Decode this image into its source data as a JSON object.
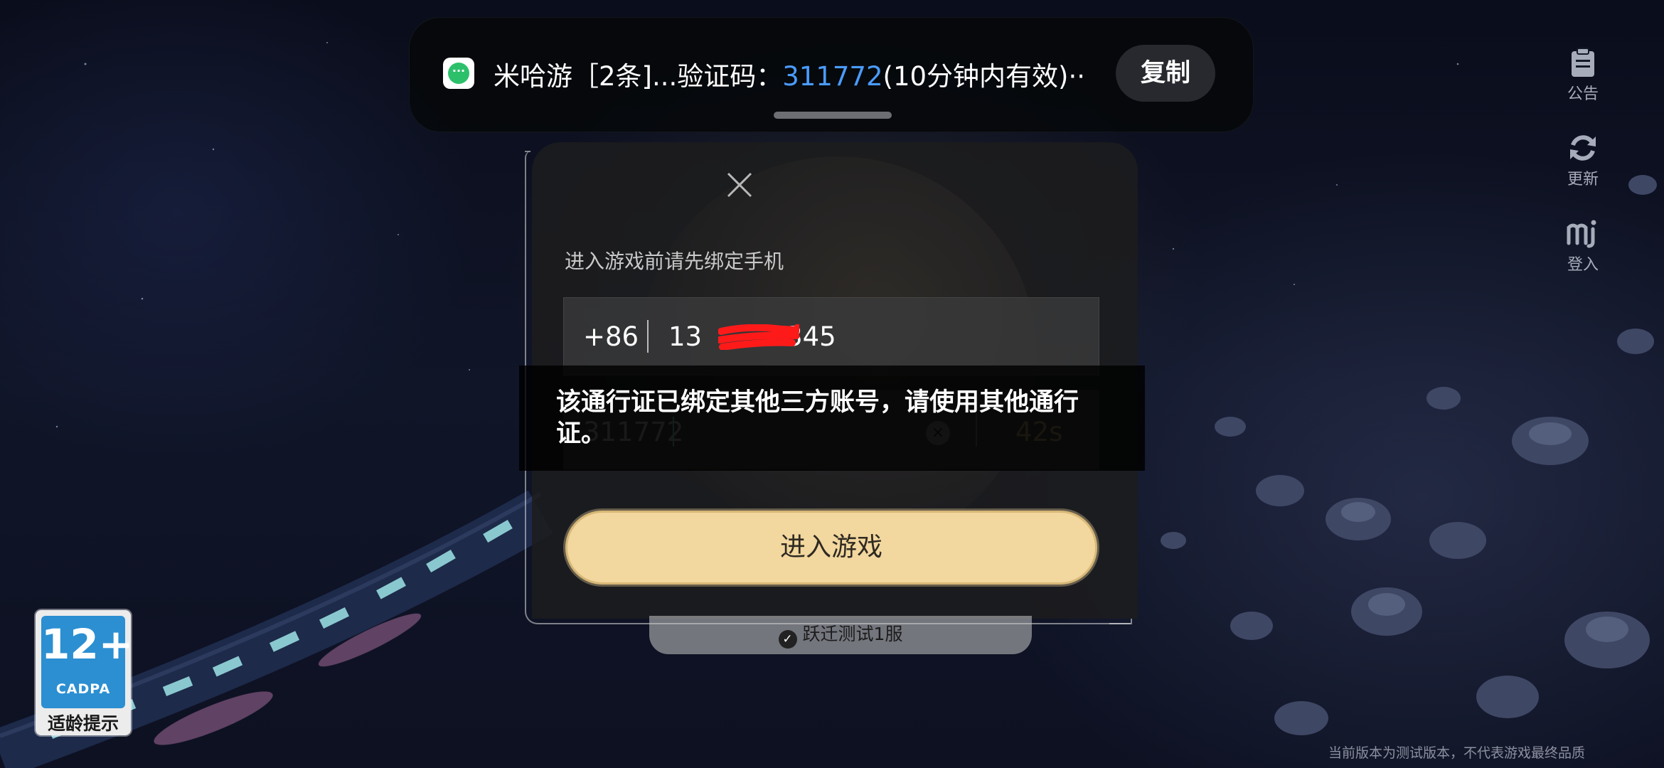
{
  "notification": {
    "app_icon": "message-bubble-icon",
    "text_prefix": "米哈游［2条]...验证码：",
    "code": "311772",
    "text_suffix": "(10分钟内有效)··",
    "copy_label": "复制"
  },
  "right_rail": {
    "announcement_label": "公告",
    "update_label": "更新",
    "login_label": "登入"
  },
  "dialog": {
    "title": "进入游戏前请先绑定手机",
    "country_code": "+86",
    "phone_visible_start": "13",
    "phone_visible_end": "345",
    "verification_code": "311772",
    "countdown": "42s",
    "clear_icon": "×",
    "submit_label": "进入游戏"
  },
  "server": {
    "label": "跃迁测试1服"
  },
  "toast": {
    "message": "该通行证已绑定其他三方账号，请使用其他通行证。"
  },
  "age_rating": {
    "age": "12+",
    "org": "CADPA",
    "label": "适龄提示"
  },
  "footer": {
    "note": "当前版本为测试版本，不代表游戏最终品质"
  },
  "colors": {
    "accent_blue": "#4a9cff",
    "button_gold": "#f2d79f",
    "rating_blue": "#2b8fd2"
  }
}
